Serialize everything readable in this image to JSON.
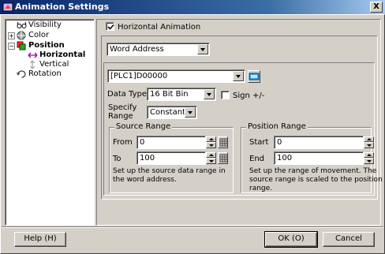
{
  "window": {
    "title": "Animation Settings",
    "close_glyph": "X"
  },
  "tree": {
    "items": [
      {
        "label": "Visibility",
        "icon": "glasses-icon"
      },
      {
        "label": "Color",
        "icon": "color-icon",
        "expander": "+"
      },
      {
        "label": "Position",
        "icon": "position-icon",
        "expander": "−"
      },
      {
        "label": "Horizontal",
        "icon": "horizontal-arrow-icon"
      },
      {
        "label": "Vertical",
        "icon": "vertical-arrow-icon"
      },
      {
        "label": "Rotation",
        "icon": "rotation-icon"
      }
    ],
    "selected": "Horizontal"
  },
  "horizontal_animation": {
    "label": "Horizontal Animation",
    "checked": true
  },
  "mode_select": {
    "value": "Word Address"
  },
  "address": {
    "value": "[PLC1]D00000"
  },
  "data_type": {
    "label": "Data Type",
    "value": "16 Bit Bin"
  },
  "sign": {
    "label": "Sign +/-",
    "checked": false
  },
  "specify_range": {
    "label_line1": "Specify",
    "label_line2": "Range",
    "value": "Constant"
  },
  "source_range": {
    "title": "Source Range",
    "from_label": "From",
    "from_value": "0",
    "to_label": "To",
    "to_value": "100",
    "note_line1": "Set up the source data range in",
    "note_line2": "the word address."
  },
  "position_range": {
    "title": "Position Range",
    "start_label": "Start",
    "start_value": "0",
    "end_label": "End",
    "end_value": "100",
    "note_line1": "Set up the range of movement. The",
    "note_line2": "source range is scaled to the position",
    "note_line3": "range."
  },
  "buttons": {
    "help": "Help (H)",
    "ok": "OK (O)",
    "cancel": "Cancel"
  }
}
